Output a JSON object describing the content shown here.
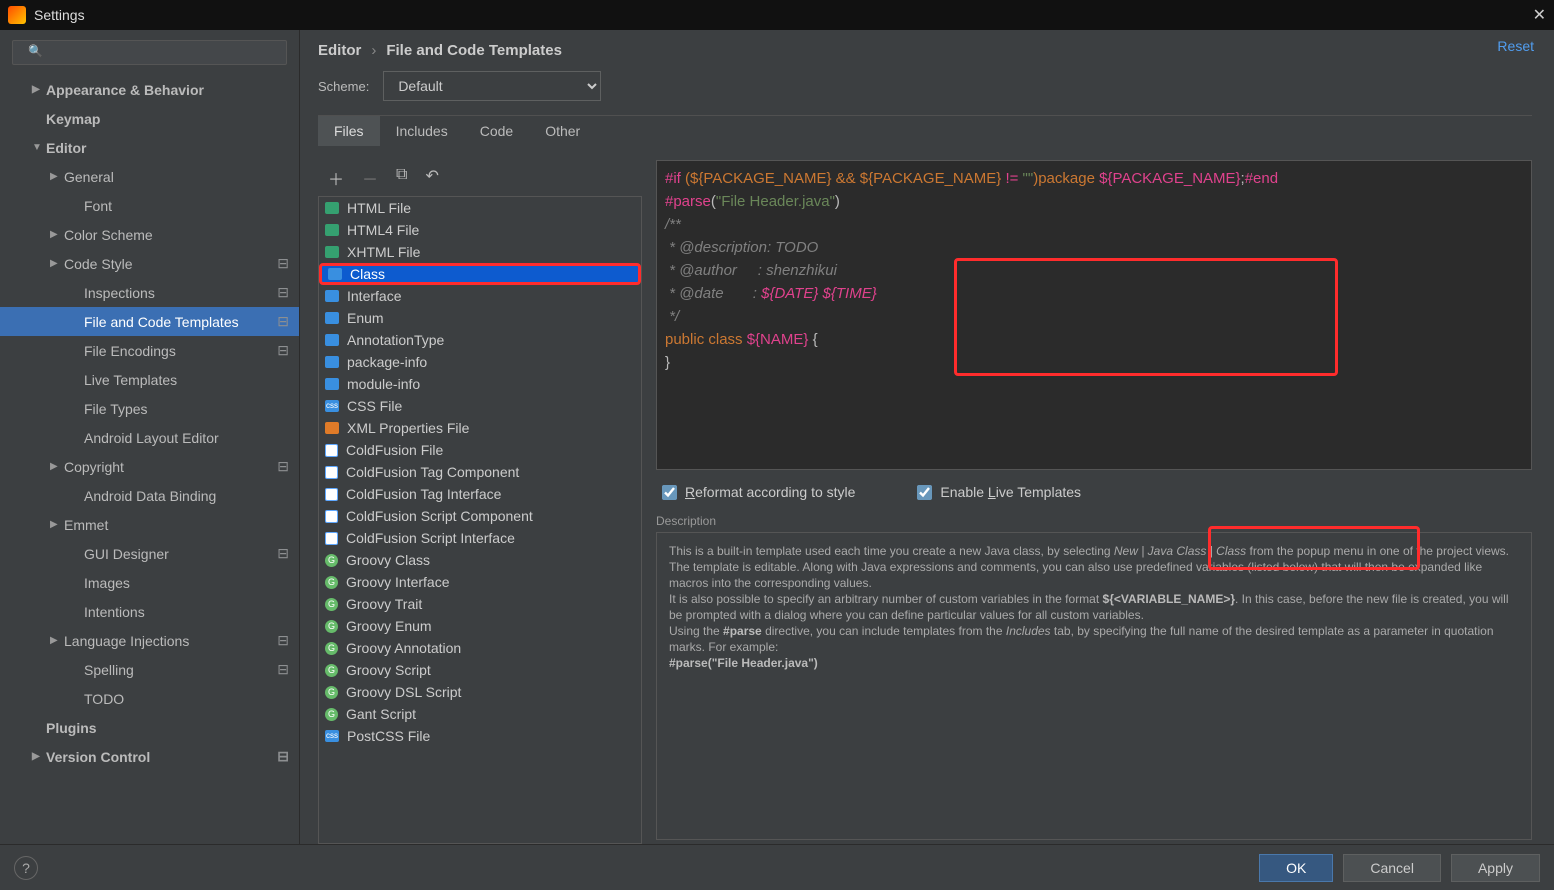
{
  "title": "Settings",
  "reset": "Reset",
  "crumb": {
    "a": "Editor",
    "b": "File and Code Templates"
  },
  "scheme": {
    "label": "Scheme:",
    "value": "Default"
  },
  "tabs": [
    "Files",
    "Includes",
    "Code",
    "Other"
  ],
  "sidebar_search_placeholder": "",
  "sidebar": [
    {
      "t": "Appearance & Behavior",
      "lvl": 0,
      "arrow": "▶",
      "bold": true
    },
    {
      "t": "Keymap",
      "lvl": 0,
      "bold": true
    },
    {
      "t": "Editor",
      "lvl": 0,
      "arrow": "▼",
      "bold": true
    },
    {
      "t": "General",
      "lvl": 1,
      "arrow": "▶"
    },
    {
      "t": "Font",
      "lvl": 2
    },
    {
      "t": "Color Scheme",
      "lvl": 1,
      "arrow": "▶"
    },
    {
      "t": "Code Style",
      "lvl": 1,
      "arrow": "▶",
      "gear": true
    },
    {
      "t": "Inspections",
      "lvl": 2,
      "gear": true
    },
    {
      "t": "File and Code Templates",
      "lvl": 2,
      "gear": true,
      "sel": true
    },
    {
      "t": "File Encodings",
      "lvl": 2,
      "gear": true
    },
    {
      "t": "Live Templates",
      "lvl": 2
    },
    {
      "t": "File Types",
      "lvl": 2
    },
    {
      "t": "Android Layout Editor",
      "lvl": 2
    },
    {
      "t": "Copyright",
      "lvl": 1,
      "arrow": "▶",
      "gear": true
    },
    {
      "t": "Android Data Binding",
      "lvl": 2
    },
    {
      "t": "Emmet",
      "lvl": 1,
      "arrow": "▶"
    },
    {
      "t": "GUI Designer",
      "lvl": 2,
      "gear": true
    },
    {
      "t": "Images",
      "lvl": 2
    },
    {
      "t": "Intentions",
      "lvl": 2
    },
    {
      "t": "Language Injections",
      "lvl": 1,
      "arrow": "▶",
      "gear": true
    },
    {
      "t": "Spelling",
      "lvl": 2,
      "gear": true
    },
    {
      "t": "TODO",
      "lvl": 2
    },
    {
      "t": "Plugins",
      "lvl": 0,
      "bold": true
    },
    {
      "t": "Version Control",
      "lvl": 0,
      "arrow": "▶",
      "bold": true,
      "gear": true
    }
  ],
  "templates": [
    {
      "t": "HTML File",
      "ic": "ic-html"
    },
    {
      "t": "HTML4 File",
      "ic": "ic-html"
    },
    {
      "t": "XHTML File",
      "ic": "ic-html"
    },
    {
      "t": "Class",
      "ic": "ic-class",
      "sel": true,
      "red": true
    },
    {
      "t": "Interface",
      "ic": "ic-class"
    },
    {
      "t": "Enum",
      "ic": "ic-class"
    },
    {
      "t": "AnnotationType",
      "ic": "ic-class"
    },
    {
      "t": "package-info",
      "ic": "ic-class"
    },
    {
      "t": "module-info",
      "ic": "ic-class"
    },
    {
      "t": "CSS File",
      "ic": "ic-css"
    },
    {
      "t": "XML Properties File",
      "ic": "ic-xml"
    },
    {
      "t": "ColdFusion File",
      "ic": "ic-cf"
    },
    {
      "t": "ColdFusion Tag Component",
      "ic": "ic-cf"
    },
    {
      "t": "ColdFusion Tag Interface",
      "ic": "ic-cf"
    },
    {
      "t": "ColdFusion Script Component",
      "ic": "ic-cf"
    },
    {
      "t": "ColdFusion Script Interface",
      "ic": "ic-cf"
    },
    {
      "t": "Groovy Class",
      "ic": "ic-g"
    },
    {
      "t": "Groovy Interface",
      "ic": "ic-g"
    },
    {
      "t": "Groovy Trait",
      "ic": "ic-g"
    },
    {
      "t": "Groovy Enum",
      "ic": "ic-g"
    },
    {
      "t": "Groovy Annotation",
      "ic": "ic-g"
    },
    {
      "t": "Groovy Script",
      "ic": "ic-g"
    },
    {
      "t": "Groovy DSL Script",
      "ic": "ic-g"
    },
    {
      "t": "Gant Script",
      "ic": "ic-g"
    },
    {
      "t": "PostCSS File",
      "ic": "ic-css"
    }
  ],
  "code": {
    "line1a": "#if ",
    "line1b": "(${PACKAGE_NAME} && ${PACKAGE_NAME} ",
    "line1c": "!= ",
    "line1d": "\"\"",
    "line1e": ")",
    "line1f": "package ",
    "line1g": "${PACKAGE_NAME}",
    "line1h": ";",
    "line1i": "#end",
    "line2a": "#parse",
    "line2b": "(",
    "line2c": "\"File Header.java\"",
    "line2d": ")",
    "c1": "/**",
    "c2": " * @description: TODO",
    "c3": " * @author     : shenzhikui",
    "c4a": " * @date       : ",
    "c4b": "${DATE} ${TIME}",
    "c5": " */",
    "line3a": "public class ",
    "line3b": "${NAME} ",
    "line3c": "{",
    "line4": "}",
    "line5": ""
  },
  "checks": {
    "reformat": "Reformat according to style",
    "live": "Enable Live Templates"
  },
  "desc_label": "Description",
  "desc": {
    "p1a": "This is a built-in template used each time you create a new Java class, by selecting ",
    "p1i": "New | Java Class | Class",
    "p1b": " from the popup menu in one of the project views.",
    "p2": "The template is editable. Along with Java expressions and comments, you can also use predefined variables (listed below) that will then be expanded like macros into the corresponding values.",
    "p3a": "It is also possible to specify an arbitrary number of custom variables in the format ",
    "p3b": "${<VARIABLE_NAME>}",
    "p3c": ". In this case, before the new file is created, you will be prompted with a dialog where you can define particular values for all custom variables.",
    "p4a": "Using the ",
    "p4b": "#parse",
    "p4c": " directive, you can include templates from the ",
    "p4i": "Includes",
    "p4d": " tab, by specifying the full name of the desired template as a parameter in quotation marks. For example:",
    "p5": "#parse(\"File Header.java\")"
  },
  "buttons": {
    "ok": "OK",
    "cancel": "Cancel",
    "apply": "Apply"
  }
}
